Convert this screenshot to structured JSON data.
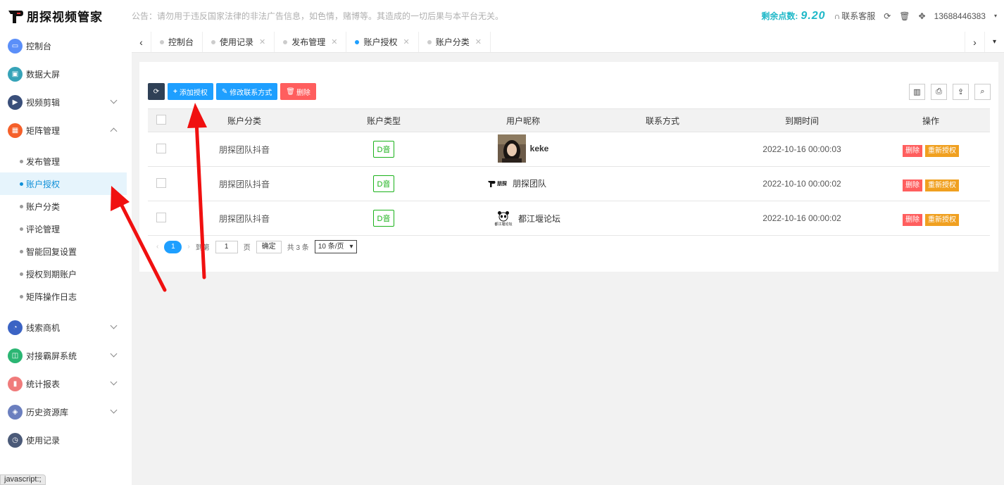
{
  "header": {
    "logo_text": "朋探视频管家",
    "notice": "公告：请勿用于违反国家法律的非法广告信息，如色情，赌博等。其造成的一切后果与本平台无关。",
    "points_label": "剩余点数:",
    "points_value": "9.20",
    "service": "联系客服",
    "phone": "13688446383"
  },
  "sidebar": {
    "items": [
      {
        "label": "控制台",
        "icon": "monitor-icon",
        "color": "#5b8ff9"
      },
      {
        "label": "数据大屏",
        "icon": "screen-icon",
        "color": "#36a3b8"
      },
      {
        "label": "视频剪辑",
        "icon": "video-icon",
        "color": "#3a4f7a"
      },
      {
        "label": "矩阵管理",
        "icon": "grid-icon",
        "color": "#f5602a"
      }
    ],
    "sub_items": [
      {
        "label": "发布管理"
      },
      {
        "label": "账户授权"
      },
      {
        "label": "账户分类"
      },
      {
        "label": "评论管理"
      },
      {
        "label": "智能回复设置"
      },
      {
        "label": "授权到期账户"
      },
      {
        "label": "矩阵操作日志"
      }
    ],
    "items_after": [
      {
        "label": "线索商机",
        "icon": "chart-icon",
        "color": "#3b63c4"
      },
      {
        "label": "对接霸屏系统",
        "icon": "layers-icon",
        "color": "#2bb673"
      },
      {
        "label": "统计报表",
        "icon": "bar-icon",
        "color": "#f07b7b"
      },
      {
        "label": "历史资源库",
        "icon": "stack-icon",
        "color": "#6b7fbf"
      },
      {
        "label": "使用记录",
        "icon": "clock-icon",
        "color": "#4b5a78"
      }
    ]
  },
  "tabs": [
    {
      "label": "控制台"
    },
    {
      "label": "使用记录"
    },
    {
      "label": "发布管理"
    },
    {
      "label": "账户授权"
    },
    {
      "label": "账户分类"
    }
  ],
  "toolbar": {
    "add": "添加授权",
    "edit": "修改联系方式",
    "delete": "删除"
  },
  "table": {
    "headers": [
      "账户分类",
      "账户类型",
      "用户昵称",
      "联系方式",
      "到期时间",
      "操作"
    ],
    "rows": [
      {
        "category": "朋探团队抖音",
        "type": "D音",
        "nickname": "keke",
        "contact": "",
        "expire": "2022-10-16 00:00:03",
        "del": "删除",
        "reauth": "重新授权"
      },
      {
        "category": "朋探团队抖音",
        "type": "D音",
        "nickname": "朋探团队",
        "contact": "",
        "expire": "2022-10-10 00:00:02",
        "del": "删除",
        "reauth": "重新授权"
      },
      {
        "category": "朋探团队抖音",
        "type": "D音",
        "nickname": "都江堰论坛",
        "contact": "",
        "expire": "2022-10-16 00:00:02",
        "del": "删除",
        "reauth": "重新授权"
      }
    ]
  },
  "pager": {
    "current": "1",
    "goto_label": "到第",
    "goto_value": "1",
    "page_unit": "页",
    "confirm": "确定",
    "total": "共 3 条",
    "page_size": "10 条/页"
  },
  "status_bar": "javascript:;",
  "avatar2_text": "朋探",
  "avatar3_text": "都江堰论坛"
}
